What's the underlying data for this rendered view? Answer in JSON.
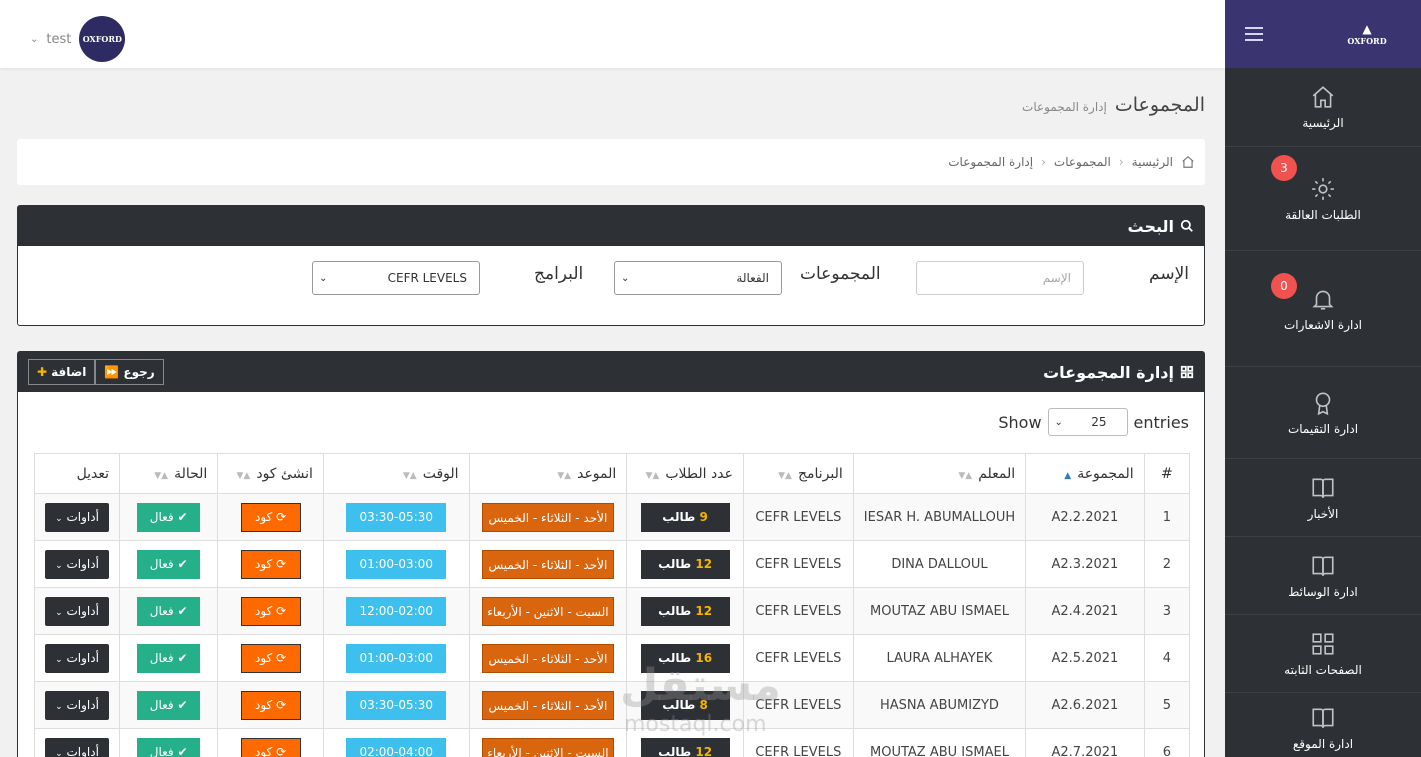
{
  "topbar": {
    "user_name": "test",
    "avatar_text": "OXFORD"
  },
  "sidebar": {
    "logo_text": "OXFORD",
    "items": [
      {
        "label": "الرئيسية",
        "icon": "home-icon"
      },
      {
        "label": "الطلبات العالقة",
        "icon": "gear-icon",
        "badge": "3"
      },
      {
        "label": "ادارة الاشعارات",
        "icon": "bell-icon",
        "badge": "0"
      },
      {
        "label": "ادارة التقيمات",
        "icon": "award-icon"
      },
      {
        "label": "الأخبار",
        "icon": "book-icon"
      },
      {
        "label": "ادارة الوسائط",
        "icon": "book-icon"
      },
      {
        "label": "الصفحات الثابته",
        "icon": "grid-icon"
      },
      {
        "label": "ادارة الموقع",
        "icon": "book-icon"
      }
    ]
  },
  "page": {
    "title": "المجموعات",
    "subtitle": "إدارة المجموعات"
  },
  "breadcrumb": {
    "home": "الرئيسية",
    "groups": "المجموعات",
    "current": "إدارة المجموعات"
  },
  "search": {
    "title": "البحث",
    "name_label": "الإسم",
    "name_placeholder": "الإسم",
    "groups_label": "المجموعات",
    "groups_value": "الفعالة",
    "programs_label": "البرامج",
    "programs_value": "CEFR LEVELS"
  },
  "groups_panel": {
    "title": "إدارة المجموعات",
    "back_label": "رجوع",
    "add_label": "اضافة",
    "show_label": "Show",
    "entries_label": "entries",
    "page_size": "25"
  },
  "table": {
    "headers": [
      "#",
      "المجموعة",
      "المعلم",
      "البرنامج",
      "عدد الطلاب",
      "الموعد",
      "الوقت",
      "انشئ كود",
      "الحالة",
      "تعديل"
    ],
    "student_word": "طالب",
    "code_label": "كود",
    "status_label": "فعال",
    "tools_label": "أداوات",
    "rows": [
      {
        "num": "1",
        "group": "A2.2.2021",
        "teacher": "IESAR H. ABUMALLOUH",
        "program": "CEFR LEVELS",
        "count": "9",
        "schedule": "الأحد - الثلاثاء - الخميس",
        "time": "03:30-05:30"
      },
      {
        "num": "2",
        "group": "A2.3.2021",
        "teacher": "DINA DALLOUL",
        "program": "CEFR LEVELS",
        "count": "12",
        "schedule": "الأحد - الثلاثاء - الخميس",
        "time": "01:00-03:00"
      },
      {
        "num": "3",
        "group": "A2.4.2021",
        "teacher": "MOUTAZ ABU ISMAEL",
        "program": "CEFR LEVELS",
        "count": "12",
        "schedule": "السبت - الاثنين - الأربعاء",
        "time": "12:00-02:00"
      },
      {
        "num": "4",
        "group": "A2.5.2021",
        "teacher": "LAURA ALHAYEK",
        "program": "CEFR LEVELS",
        "count": "16",
        "schedule": "الأحد - الثلاثاء - الخميس",
        "time": "01:00-03:00"
      },
      {
        "num": "5",
        "group": "A2.6.2021",
        "teacher": "HASNA ABUMIZYD",
        "program": "CEFR LEVELS",
        "count": "8",
        "schedule": "الأحد - الثلاثاء - الخميس",
        "time": "03:30-05:30"
      },
      {
        "num": "6",
        "group": "A2.7.2021",
        "teacher": "MOUTAZ ABU ISMAEL",
        "program": "CEFR LEVELS",
        "count": "12",
        "schedule": "السبت - الاثنين - الأربعاء",
        "time": "02:00-04:00"
      }
    ]
  },
  "watermark": {
    "brand": "مستقل",
    "domain": "mostaql.com"
  },
  "colors": {
    "sidebar_bg": "#2d3135",
    "brand_top": "#3a3470",
    "schedule": "#d9650e",
    "time": "#3dc0ee",
    "code": "#ff6a00",
    "status": "#26b089"
  }
}
